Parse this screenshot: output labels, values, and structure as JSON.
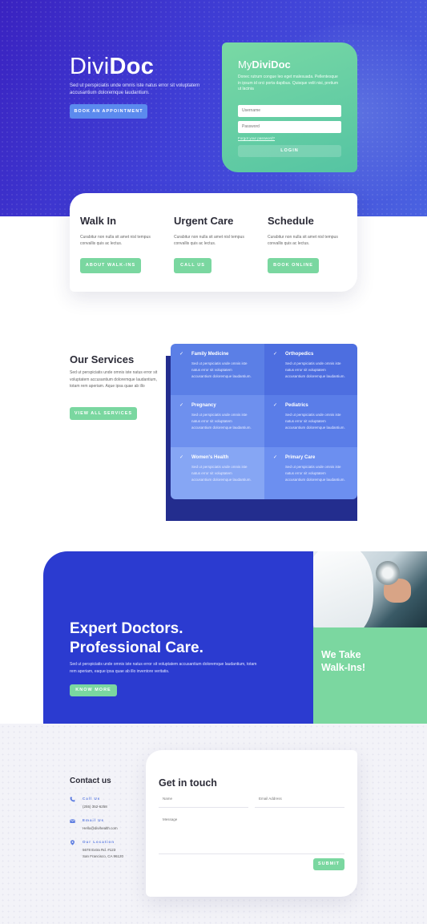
{
  "hero": {
    "logo_light": "Divi",
    "logo_bold": "Doc",
    "description": "Sed ut perspiciatis unde omnis iste natus error sit voluptatem accusantium doloremque laudantium.",
    "cta_label": "Book an Appointment"
  },
  "login": {
    "title_light": "My",
    "title_bold": "DiviDoc",
    "description": "Donec rutrum congue leo eget malesuada. Pellentesque in ipsum id orci porta dapibus. Quisque velit nisi, pretium ut lacinia",
    "username_placeholder": "Username",
    "password_placeholder": "Password",
    "forgot_label": "Forgot your password?",
    "login_label": "Login"
  },
  "cards": [
    {
      "title": "Walk In",
      "text": "Curabitur non nulla sit amet nisl tempus convallis quis ac lectus.",
      "button": "About Walk-ins"
    },
    {
      "title": "Urgent Care",
      "text": "Curabitur non nulla sit amet nisl tempus convallis quis ac lectus.",
      "button": "Call Us"
    },
    {
      "title": "Schedule",
      "text": "Curabitur non nulla sit amet nisl tempus convallis quis ac lectus.",
      "button": "Book Online"
    }
  ],
  "services": {
    "title": "Our Services",
    "text": "Sed ut perspiciatis unde omnis iste natus error sit voluptatem accusantium doloremque laudantium, totam rem aperiam. Aque ipsa quae ab illo",
    "button": "View All Services",
    "items": [
      {
        "title": "Family Medicine",
        "text": "Sed ut perspiciatis unde omnis iste natus error sit voluptatem accusantium doloremque laudantium.",
        "color": "#5b7fe6"
      },
      {
        "title": "Orthopedics",
        "text": "Sed ut perspiciatis unde omnis iste natus error sit voluptatem accusantium doloremque laudantium.",
        "color": "#4d6ee0"
      },
      {
        "title": "Pregnancy",
        "text": "Sed ut perspiciatis unde omnis iste natus error sit voluptatem accusantium doloremque laudantium.",
        "color": "#6e90ee"
      },
      {
        "title": "Pediatrics",
        "text": "Sed ut perspiciatis unde omnis iste natus error sit voluptatem accusantium doloremque laudantium.",
        "color": "#5a7de8"
      },
      {
        "title": "Women's Health",
        "text": "Sed ut perspiciatis unde omnis iste natus error sit voluptatem accusantium doloremque laudantium.",
        "color": "#86a6f4"
      },
      {
        "title": "Primary Care",
        "text": "Sed ut perspiciatis unde omnis iste natus error sit voluptatem accusantium doloremque laudantium.",
        "color": "#6c8ff0"
      }
    ]
  },
  "expert": {
    "title_line1": "Expert Doctors.",
    "title_line2": "Professional Care.",
    "text": "Sed ut perspiciatis unde omnis iste natus error sit voluptatem accusantium doloremque laudantium, totam rem aperiam, eaque ipsa quae ab illo inventore veritatis.",
    "button": "Know More",
    "walkins_line1": "We Take",
    "walkins_line2": "Walk-Ins!"
  },
  "contact": {
    "title": "Contact us",
    "call_label": "Call Us",
    "call_value": "(255) 352-6258",
    "email_label": "Email Us",
    "email_value": "Hello@divihealth.com",
    "location_label": "Our Location",
    "location_line1": "5678 Extra Rd. #123",
    "location_line2": "San Francisco, CA 96120"
  },
  "form": {
    "title": "Get in touch",
    "name_placeholder": "Name",
    "email_placeholder": "Email Address",
    "message_placeholder": "Message",
    "submit_label": "Submit"
  },
  "colors": {
    "hero_gradient": "#3a22c0",
    "accent_green": "#7ad7a0",
    "accent_blue": "#5b8aee",
    "expert_blue": "#2b3bd0"
  }
}
